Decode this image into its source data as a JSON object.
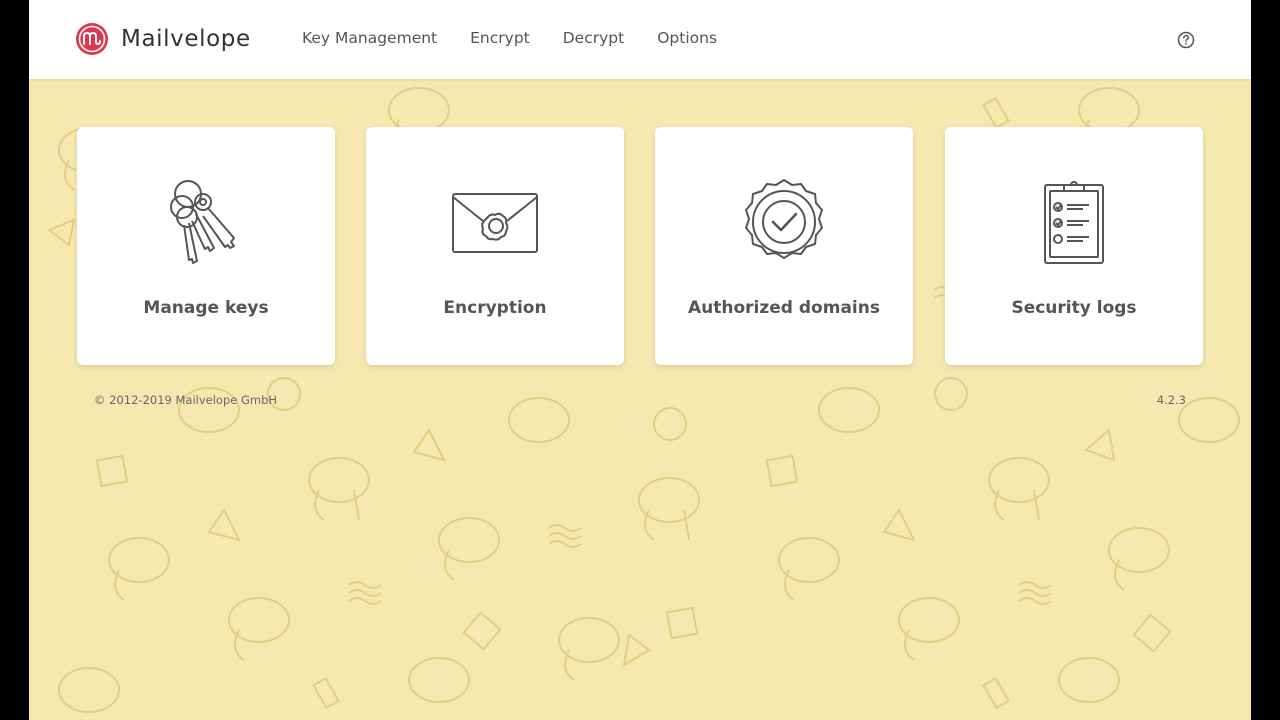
{
  "header": {
    "brand": "Mailvelope",
    "nav": [
      "Key Management",
      "Encrypt",
      "Decrypt",
      "Options"
    ],
    "help_icon": "question-circle-icon"
  },
  "cards": [
    {
      "label": "Manage keys",
      "icon": "keys-icon"
    },
    {
      "label": "Encryption",
      "icon": "sealed-envelope-icon"
    },
    {
      "label": "Authorized domains",
      "icon": "verified-badge-icon"
    },
    {
      "label": "Security logs",
      "icon": "clipboard-checklist-icon"
    }
  ],
  "footer": {
    "copyright": "© 2012-2019  Mailvelope GmbH",
    "version": "4.2.3"
  },
  "colors": {
    "background": "#f6e9b0",
    "brand_red": "#e0364e",
    "text": "#555555"
  }
}
